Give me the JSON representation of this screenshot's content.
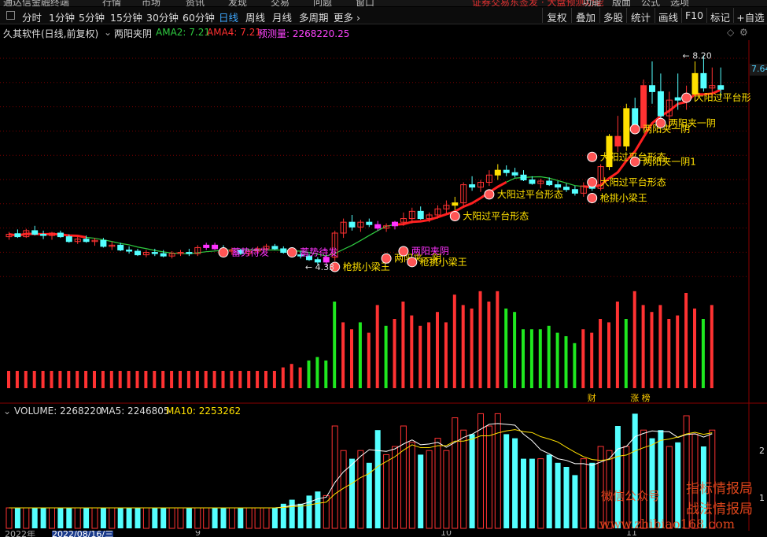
{
  "menu": {
    "items": [
      "通达信金融终端",
      "行情",
      "市场",
      "资讯",
      "发现",
      "交易",
      "问题",
      "窗口"
    ],
    "promo": "证券交易东签发 · 大盘预测功能",
    "right_items": [
      "功能",
      "版面",
      "公式",
      "选项"
    ]
  },
  "toolbar": {
    "timeframes": [
      "分时",
      "1分钟",
      "5分钟",
      "15分钟",
      "30分钟",
      "60分钟",
      "日线",
      "周线",
      "月线",
      "多周期",
      "更多 ›"
    ],
    "active_timeframe": "日线",
    "tools": [
      "复权",
      "叠加",
      "多股",
      "统计",
      "画线",
      "F10",
      "标记",
      "+自选"
    ]
  },
  "info": {
    "title": "久其软件(日线,前复权)",
    "indicator": "两阳夹阴",
    "ama2": "AMA2: 7.21",
    "ama4": "AMA4: 7.21",
    "predict": "预测量: 2268220.25"
  },
  "volume_info": {
    "vol": "VOLUME: 2268220",
    "ma5": "MA5: 2246805",
    "ma10": "MA10: 2253262"
  },
  "side_price": "7.64",
  "axis_labels": {
    "vol_right_top": "2",
    "vol_right_bottom": "1"
  },
  "watermark": {
    "line1": "微信公众号",
    "line2": "指标情报局",
    "line3": "战法情报局",
    "url": "www.zhibiao168.com"
  },
  "dates": [
    "2022年",
    "2022/08/16/三",
    "9",
    "10",
    "11"
  ],
  "colors": {
    "up": "#ff3232",
    "down": "#54ffff",
    "green_vol": "#1fe81f",
    "ama_red": "#ff2020",
    "ama_green": "#2ecc40",
    "yellow": "#ffe000",
    "magenta": "#ff33ff"
  },
  "chart_data": {
    "type": "candlestick",
    "candles": [
      [
        5.2,
        5.28,
        5.15,
        5.24,
        "up"
      ],
      [
        5.25,
        5.32,
        5.18,
        5.2,
        "dn"
      ],
      [
        5.2,
        5.33,
        5.18,
        5.3,
        "up"
      ],
      [
        5.3,
        5.38,
        5.22,
        5.24,
        "dn"
      ],
      [
        5.24,
        5.3,
        5.16,
        5.22,
        "dn"
      ],
      [
        5.22,
        5.28,
        5.15,
        5.26,
        "up"
      ],
      [
        5.26,
        5.3,
        5.18,
        5.2,
        "dn"
      ],
      [
        5.2,
        5.24,
        5.1,
        5.12,
        "dn"
      ],
      [
        5.12,
        5.2,
        5.08,
        5.16,
        "up"
      ],
      [
        5.16,
        5.22,
        5.1,
        5.12,
        "dn"
      ],
      [
        5.12,
        5.18,
        5.05,
        5.14,
        "up"
      ],
      [
        5.14,
        5.18,
        5.02,
        5.04,
        "dn"
      ],
      [
        5.04,
        5.12,
        4.98,
        5.06,
        "up"
      ],
      [
        5.06,
        5.1,
        4.96,
        4.98,
        "dn"
      ],
      [
        4.98,
        5.04,
        4.92,
        4.96,
        "dn"
      ],
      [
        4.96,
        5.0,
        4.88,
        4.9,
        "dn"
      ],
      [
        4.9,
        4.98,
        4.86,
        4.94,
        "up"
      ],
      [
        4.94,
        5.0,
        4.88,
        4.92,
        "dn"
      ],
      [
        4.92,
        4.98,
        4.86,
        4.88,
        "dn"
      ],
      [
        4.88,
        4.96,
        4.84,
        4.92,
        "up"
      ],
      [
        4.92,
        4.98,
        4.88,
        4.94,
        "up"
      ],
      [
        4.94,
        5.0,
        4.88,
        4.92,
        "dn"
      ],
      [
        4.92,
        5.06,
        4.88,
        5.02,
        "up"
      ],
      [
        5.02,
        5.1,
        4.98,
        5.06,
        "up"
      ],
      [
        5.06,
        5.1,
        4.98,
        5.0,
        "dn"
      ],
      [
        5.0,
        5.06,
        4.92,
        4.96,
        "dn"
      ],
      [
        4.96,
        5.02,
        4.9,
        4.98,
        "up"
      ],
      [
        4.98,
        5.0,
        4.9,
        4.92,
        "dn"
      ],
      [
        4.92,
        4.98,
        4.88,
        4.96,
        "up"
      ],
      [
        4.96,
        5.04,
        4.92,
        5.0,
        "up"
      ],
      [
        5.0,
        5.08,
        4.96,
        5.04,
        "up"
      ],
      [
        5.04,
        5.08,
        4.98,
        5.0,
        "dn"
      ],
      [
        5.0,
        5.04,
        4.92,
        4.94,
        "dn"
      ],
      [
        4.94,
        5.0,
        4.86,
        4.9,
        "dn"
      ],
      [
        4.9,
        4.96,
        4.84,
        4.88,
        "dn"
      ],
      [
        4.88,
        4.92,
        4.8,
        4.82,
        "dn"
      ],
      [
        4.82,
        4.86,
        4.74,
        4.78,
        "dn"
      ],
      [
        4.78,
        4.9,
        4.7,
        4.86,
        "up"
      ],
      [
        4.86,
        5.3,
        4.8,
        5.26,
        "up"
      ],
      [
        5.26,
        5.5,
        5.18,
        5.44,
        "up"
      ],
      [
        5.44,
        5.56,
        5.3,
        5.36,
        "dn"
      ],
      [
        5.36,
        5.48,
        5.28,
        5.44,
        "up"
      ],
      [
        5.44,
        5.5,
        5.36,
        5.4,
        "dn"
      ],
      [
        5.4,
        5.46,
        5.3,
        5.34,
        "dn"
      ],
      [
        5.34,
        5.42,
        5.28,
        5.38,
        "up"
      ],
      [
        5.38,
        5.46,
        5.32,
        5.44,
        "up"
      ],
      [
        5.44,
        5.6,
        5.38,
        5.5,
        "up"
      ],
      [
        5.5,
        5.68,
        5.42,
        5.62,
        "up"
      ],
      [
        5.62,
        5.7,
        5.48,
        5.5,
        "dn"
      ],
      [
        5.5,
        5.6,
        5.44,
        5.56,
        "up"
      ],
      [
        5.56,
        5.72,
        5.5,
        5.66,
        "up"
      ],
      [
        5.66,
        5.8,
        5.58,
        5.72,
        "up"
      ],
      [
        5.72,
        5.86,
        5.64,
        5.76,
        "up"
      ],
      [
        5.76,
        6.1,
        5.7,
        6.06,
        "up"
      ],
      [
        6.06,
        6.2,
        5.96,
        6.02,
        "dn"
      ],
      [
        6.02,
        6.14,
        5.94,
        6.1,
        "up"
      ],
      [
        6.1,
        6.3,
        6.04,
        6.22,
        "up"
      ],
      [
        6.22,
        6.4,
        6.14,
        6.3,
        "up"
      ],
      [
        6.3,
        6.38,
        6.2,
        6.26,
        "dn"
      ],
      [
        6.26,
        6.34,
        6.18,
        6.22,
        "dn"
      ],
      [
        6.22,
        6.3,
        6.12,
        6.14,
        "dn"
      ],
      [
        6.14,
        6.2,
        6.06,
        6.08,
        "dn"
      ],
      [
        6.08,
        6.16,
        6.0,
        6.12,
        "up"
      ],
      [
        6.12,
        6.18,
        6.04,
        6.06,
        "dn"
      ],
      [
        6.06,
        6.12,
        5.98,
        6.02,
        "dn"
      ],
      [
        6.02,
        6.08,
        5.94,
        5.98,
        "dn"
      ],
      [
        5.98,
        6.04,
        5.88,
        5.92,
        "dn"
      ],
      [
        5.92,
        6.1,
        5.86,
        6.04,
        "up"
      ],
      [
        6.04,
        6.12,
        5.96,
        6.0,
        "dn"
      ],
      [
        6.0,
        6.4,
        5.96,
        6.36,
        "up"
      ],
      [
        6.36,
        6.9,
        6.3,
        6.86,
        "up"
      ],
      [
        6.86,
        7.2,
        6.6,
        6.7,
        "dn"
      ],
      [
        6.7,
        7.4,
        6.62,
        7.32,
        "up"
      ],
      [
        7.32,
        7.5,
        6.9,
        7.0,
        "dn"
      ],
      [
        7.0,
        7.8,
        6.96,
        7.7,
        "up"
      ],
      [
        7.7,
        8.1,
        7.4,
        7.6,
        "dn"
      ],
      [
        7.6,
        7.9,
        7.1,
        7.2,
        "dn"
      ],
      [
        7.2,
        7.6,
        7.0,
        7.46,
        "up"
      ],
      [
        7.46,
        7.9,
        7.3,
        7.5,
        "dn"
      ],
      [
        7.5,
        7.7,
        7.3,
        7.56,
        "up"
      ],
      [
        7.56,
        8.1,
        7.44,
        7.9,
        "up"
      ],
      [
        7.9,
        8.2,
        7.6,
        7.66,
        "dn"
      ],
      [
        7.66,
        8.0,
        7.5,
        7.7,
        "up"
      ],
      [
        7.7,
        8.0,
        7.5,
        7.64,
        "dn"
      ]
    ],
    "volumes": [
      1.0,
      1.0,
      1.0,
      1.0,
      1.0,
      1.0,
      1.0,
      1.0,
      1.0,
      1.0,
      1.0,
      1.0,
      1.0,
      1.0,
      1.0,
      1.0,
      1.0,
      1.0,
      1.0,
      1.0,
      1.0,
      1.0,
      1.0,
      1.0,
      1.0,
      1.0,
      1.0,
      1.0,
      1.0,
      1.0,
      1.0,
      1.0,
      1.2,
      1.4,
      1.2,
      1.6,
      1.8,
      1.6,
      5.0,
      3.8,
      3.4,
      3.8,
      3.2,
      4.8,
      3.6,
      4.0,
      5.0,
      4.2,
      3.6,
      3.8,
      4.4,
      3.8,
      5.4,
      4.8,
      4.6,
      5.6,
      5.0,
      5.6,
      4.6,
      4.4,
      3.4,
      3.4,
      3.4,
      3.6,
      3.2,
      3.0,
      2.6,
      3.4,
      3.2,
      4.0,
      3.8,
      5.0,
      4.0,
      5.6,
      4.8,
      4.4,
      4.8,
      4.0,
      4.2,
      5.5,
      4.6,
      4.0,
      4.8
    ],
    "vol_colors": [
      "r",
      "r",
      "r",
      "r",
      "r",
      "r",
      "r",
      "r",
      "r",
      "r",
      "r",
      "r",
      "r",
      "r",
      "r",
      "r",
      "r",
      "r",
      "r",
      "r",
      "r",
      "r",
      "r",
      "r",
      "r",
      "r",
      "r",
      "r",
      "r",
      "r",
      "r",
      "r",
      "r",
      "r",
      "r",
      "g",
      "g",
      "g",
      "g",
      "r",
      "r",
      "g",
      "r",
      "r",
      "g",
      "r",
      "r",
      "r",
      "r",
      "r",
      "r",
      "r",
      "r",
      "r",
      "r",
      "r",
      "r",
      "r",
      "g",
      "g",
      "g",
      "g",
      "g",
      "g",
      "g",
      "g",
      "g",
      "r",
      "r",
      "r",
      "r",
      "r",
      "g",
      "r",
      "r",
      "r",
      "r",
      "r",
      "r",
      "r",
      "r",
      "g",
      "r"
    ],
    "labels": [
      {
        "i": 25,
        "p": 4.94,
        "text": "蓄势待发",
        "color": "magenta"
      },
      {
        "i": 33,
        "p": 4.94,
        "text": "蓄势待发",
        "color": "magenta"
      },
      {
        "i": 38,
        "p": 4.7,
        "text": "枪挑小梁王",
        "color": "yellow"
      },
      {
        "i": 44,
        "p": 4.84,
        "text": "两阳夹一阴",
        "color": "yellow"
      },
      {
        "i": 47,
        "p": 4.78,
        "text": "枪挑小梁王",
        "color": "yellow"
      },
      {
        "i": 46,
        "p": 4.96,
        "text": "两阳夹阴",
        "color": "magenta"
      },
      {
        "i": 52,
        "p": 5.54,
        "text": "大阳过平台形态",
        "color": "yellow"
      },
      {
        "i": 56,
        "p": 5.9,
        "text": "大阳过平台形态",
        "color": "yellow"
      },
      {
        "i": 68,
        "p": 5.84,
        "text": "枪挑小梁王",
        "color": "yellow"
      },
      {
        "i": 68,
        "p": 6.1,
        "text": "大阳过平台形态",
        "color": "yellow"
      },
      {
        "i": 68,
        "p": 6.52,
        "text": "大阳过平台形态",
        "color": "yellow"
      },
      {
        "i": 73,
        "p": 6.44,
        "text": "两阳夹一阴1",
        "color": "yellow"
      },
      {
        "i": 73,
        "p": 6.98,
        "text": "两阳夹一阴",
        "color": "yellow"
      },
      {
        "i": 76,
        "p": 7.08,
        "text": "两阳夹一阴",
        "color": "yellow"
      },
      {
        "i": 79,
        "p": 7.5,
        "text": "大阳过平台形",
        "color": "yellow"
      }
    ],
    "price_marks": [
      {
        "i": 36,
        "p": 4.7,
        "text": "4.33"
      },
      {
        "i": 80,
        "p": 8.2,
        "text": "8.20"
      }
    ],
    "markers": [
      {
        "i": 68,
        "text": "财"
      },
      {
        "i": 73,
        "text": "涨 榜"
      }
    ],
    "y_range": [
      4.4,
      8.4
    ]
  }
}
